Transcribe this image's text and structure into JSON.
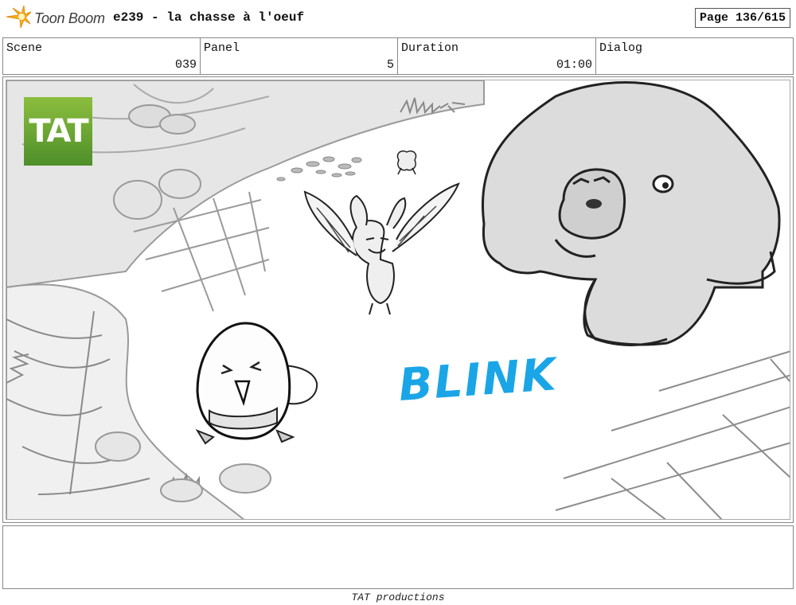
{
  "header": {
    "brand": "Toon Boom",
    "brand_icon": "toon-boom-star-icon",
    "title": "e239 - la chasse à l'oeuf",
    "page": "Page 136/615"
  },
  "fields": {
    "scene": {
      "label": "Scene",
      "value": "039"
    },
    "panel": {
      "label": "Panel",
      "value": "5"
    },
    "duration": {
      "label": "Duration",
      "value": "01:00"
    },
    "dialog": {
      "label": "Dialog",
      "value": ""
    }
  },
  "artwork": {
    "studio_logo": "TAT",
    "sound_effect": "BLINK",
    "sound_effect_color": "#1aa6e6",
    "logo_colors": [
      "#8cbe3e",
      "#4e8f2a"
    ]
  },
  "footer": {
    "text": "TAT productions"
  }
}
